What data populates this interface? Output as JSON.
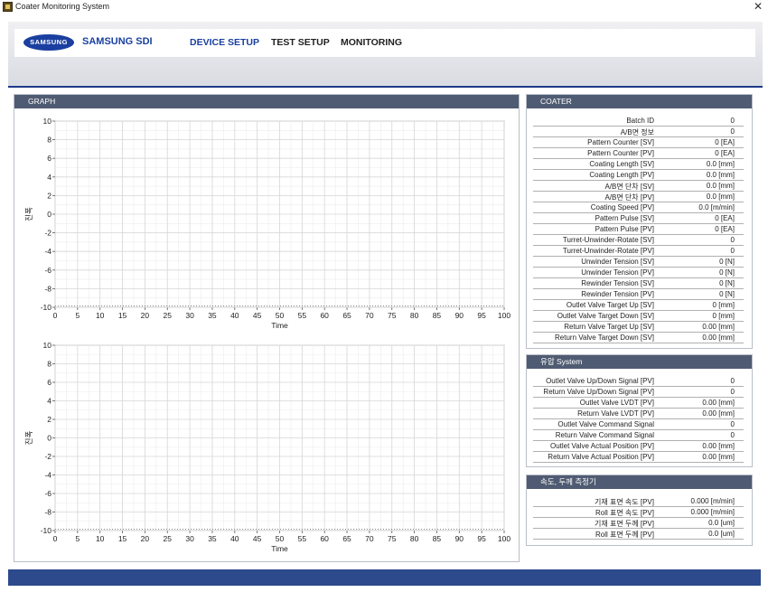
{
  "window": {
    "title": "Coater Monitoring System"
  },
  "header": {
    "logo_text": "SAMSUNG",
    "brand": "SAMSUNG SDI",
    "menu": [
      {
        "label": "DEVICE SETUP"
      },
      {
        "label": "TEST SETUP"
      },
      {
        "label": "MONITORING"
      }
    ]
  },
  "graph_panel": {
    "title": "GRAPH",
    "charts": [
      {
        "ylabel": "진폭",
        "xlabel": "Time"
      },
      {
        "ylabel": "진폭",
        "xlabel": "Time"
      }
    ]
  },
  "chart_data": [
    {
      "type": "line",
      "xlabel": "Time",
      "ylabel": "진폭",
      "xlim": [
        0,
        100
      ],
      "ylim": [
        -10,
        10
      ],
      "x_ticks": [
        0,
        5,
        10,
        15,
        20,
        25,
        30,
        35,
        40,
        45,
        50,
        55,
        60,
        65,
        70,
        75,
        80,
        85,
        90,
        95,
        100
      ],
      "y_ticks": [
        10,
        8,
        6,
        4,
        2,
        0,
        -2,
        -4,
        -6,
        -8,
        -10
      ],
      "grid": true,
      "series": []
    },
    {
      "type": "line",
      "xlabel": "Time",
      "ylabel": "진폭",
      "xlim": [
        0,
        100
      ],
      "ylim": [
        -10,
        10
      ],
      "x_ticks": [
        0,
        5,
        10,
        15,
        20,
        25,
        30,
        35,
        40,
        45,
        50,
        55,
        60,
        65,
        70,
        75,
        80,
        85,
        90,
        95,
        100
      ],
      "y_ticks": [
        10,
        8,
        6,
        4,
        2,
        0,
        -2,
        -4,
        -6,
        -8,
        -10
      ],
      "grid": true,
      "series": []
    }
  ],
  "coater": {
    "title": "COATER",
    "rows": [
      {
        "label": "Batch ID",
        "value": "0"
      },
      {
        "label": "A/B면 정보",
        "value": "0"
      },
      {
        "label": "Pattern Counter [SV]",
        "value": "0 [EA]"
      },
      {
        "label": "Pattern Counter [PV]",
        "value": "0 [EA]"
      },
      {
        "label": "Coating Length [SV]",
        "value": "0.0 [mm]"
      },
      {
        "label": "Coating Length [PV]",
        "value": "0.0 [mm]"
      },
      {
        "label": "A/B면 단차 [SV]",
        "value": "0.0 [mm]"
      },
      {
        "label": "A/B면 단차 [PV]",
        "value": "0.0 [mm]"
      },
      {
        "label": "Coating Speed [PV]",
        "value": "0.0 [m/min]"
      },
      {
        "label": "Pattern Pulse [SV]",
        "value": "0 [EA]"
      },
      {
        "label": "Pattern Pulse [PV]",
        "value": "0 [EA]"
      },
      {
        "label": "Turret-Unwinder-Rotate [SV]",
        "value": "0"
      },
      {
        "label": "Turret-Unwinder-Rotate [PV]",
        "value": "0"
      },
      {
        "label": "Unwinder Tension [SV]",
        "value": "0 [N]"
      },
      {
        "label": "Unwinder Tension [PV]",
        "value": "0 [N]"
      },
      {
        "label": "Rewinder Tension [SV]",
        "value": "0 [N]"
      },
      {
        "label": "Rewinder Tension [PV]",
        "value": "0 [N]"
      },
      {
        "label": "Outlet Valve Target Up [SV]",
        "value": "0 [mm]"
      },
      {
        "label": "Outlet Valve Target Down [SV]",
        "value": "0 [mm]"
      },
      {
        "label": "Return Valve Target Up [SV]",
        "value": "0.00 [mm]"
      },
      {
        "label": "Return Valve Target Down [SV]",
        "value": "0.00 [mm]"
      }
    ]
  },
  "hydraulic": {
    "title": "유압 System",
    "rows": [
      {
        "label": "Outlet Valve Up/Down Signal [PV]",
        "value": "0"
      },
      {
        "label": "Return Valve Up/Down Signal [PV]",
        "value": "0"
      },
      {
        "label": "Outlet Valve LVDT [PV]",
        "value": "0.00 [mm]"
      },
      {
        "label": "Return Valve LVDT [PV]",
        "value": "0.00 [mm]"
      },
      {
        "label": "Outlet Valve Command Signal",
        "value": "0"
      },
      {
        "label": "Return Valve Command Signal",
        "value": "0"
      },
      {
        "label": "Outlet Valve Actual Position [PV]",
        "value": "0.00 [mm]"
      },
      {
        "label": "Return Valve Actual Position [PV]",
        "value": "0.00 [mm]"
      }
    ]
  },
  "speed_thickness": {
    "title": "속도, 두께 측정기",
    "rows": [
      {
        "label": "기재 표면 속도 [PV]",
        "value": "0.000 [m/min]"
      },
      {
        "label": "Roll 표면 속도 [PV]",
        "value": "0.000 [m/min]"
      },
      {
        "label": "기재 표면 두께 [PV]",
        "value": "0.0 [um]"
      },
      {
        "label": "Roll 표면 두께 [PV]",
        "value": "0.0 [um]"
      }
    ]
  }
}
